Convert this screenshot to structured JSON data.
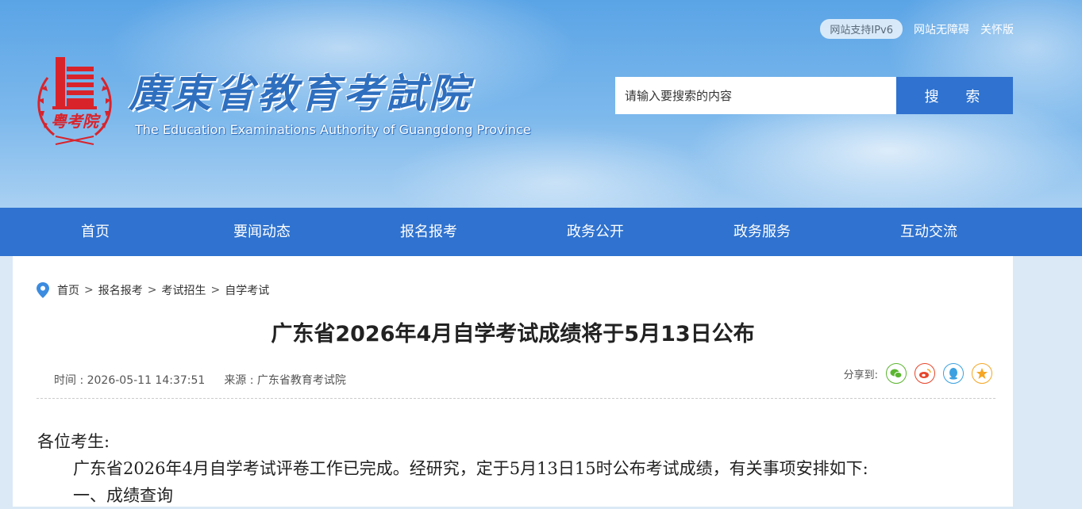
{
  "header": {
    "ipv6_badge": "网站支持IPv6",
    "accessibility_link": "网站无障碍",
    "care_link": "关怀版",
    "site_title": "廣東省教育考試院",
    "site_subtitle": "The Education Examinations Authority of Guangdong Province",
    "emblem_text": "粤考院"
  },
  "search": {
    "placeholder": "请输入要搜索的内容",
    "button_label": "搜 索"
  },
  "nav": {
    "items": [
      {
        "label": "首页"
      },
      {
        "label": "要闻动态"
      },
      {
        "label": "报名报考"
      },
      {
        "label": "政务公开"
      },
      {
        "label": "政务服务"
      },
      {
        "label": "互动交流"
      }
    ]
  },
  "breadcrumb": [
    "首页",
    "报名报考",
    "考试招生",
    "自学考试"
  ],
  "breadcrumb_separator": ">",
  "article": {
    "title": "广东省2026年4月自学考试成绩将于5月13日公布",
    "time": "时间 : 2026-05-11 14:37:51",
    "source": "来源 : 广东省教育考试院",
    "share_label": "分享到:",
    "greeting": "各位考生:",
    "paragraph1": "广东省2026年4月自学考试评卷工作已完成。经研究，定于5月13日15时公布考试成绩，有关事项安排如下:",
    "section1": "一、成绩查询"
  },
  "share_icons": [
    {
      "name": "wechat-icon",
      "color": "#5cb531"
    },
    {
      "name": "weibo-icon",
      "color": "#e6452b"
    },
    {
      "name": "qq-icon",
      "color": "#3ba1e0"
    },
    {
      "name": "qzone-icon",
      "color": "#f5a623"
    }
  ],
  "colors": {
    "primary_blue": "#2f72cf",
    "emblem_red": "#d9232b"
  }
}
